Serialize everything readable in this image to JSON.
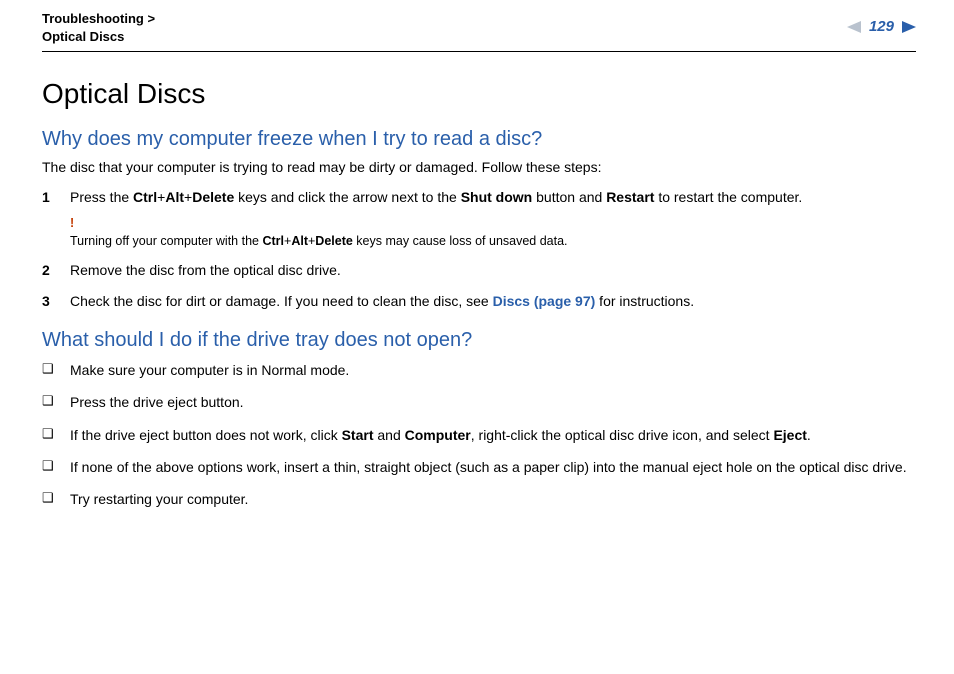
{
  "header": {
    "breadcrumb_section": "Troubleshooting",
    "breadcrumb_sep": " > ",
    "breadcrumb_page": "Optical Discs",
    "page_number": "129"
  },
  "title": "Optical Discs",
  "q1": {
    "heading": "Why does my computer freeze when I try to read a disc?",
    "intro": "The disc that your computer is trying to read may be dirty or damaged. Follow these steps:",
    "step1_a": "Press the ",
    "step1_b": "Ctrl",
    "step1_c": "+",
    "step1_d": "Alt",
    "step1_e": "+",
    "step1_f": "Delete",
    "step1_g": " keys and click the arrow next to the ",
    "step1_h": "Shut down",
    "step1_i": " button and ",
    "step1_j": "Restart",
    "step1_k": " to restart the computer.",
    "warn_bang": "!",
    "warn_a": "Turning off your computer with the ",
    "warn_b": "Ctrl",
    "warn_c": "+",
    "warn_d": "Alt",
    "warn_e": "+",
    "warn_f": "Delete",
    "warn_g": " keys may cause loss of unsaved data.",
    "step2": "Remove the disc from the optical disc drive.",
    "step3_a": "Check the disc for dirt or damage. If you need to clean the disc, see ",
    "step3_b": "Discs (page 97)",
    "step3_c": " for instructions."
  },
  "q2": {
    "heading": "What should I do if the drive tray does not open?",
    "b1": "Make sure your computer is in Normal mode.",
    "b2": "Press the drive eject button.",
    "b3_a": "If the drive eject button does not work, click ",
    "b3_b": "Start",
    "b3_c": " and ",
    "b3_d": "Computer",
    "b3_e": ", right-click the optical disc drive icon, and select ",
    "b3_f": "Eject",
    "b3_g": ".",
    "b4": "If none of the above options work, insert a thin, straight object (such as a paper clip) into the manual eject hole on the optical disc drive.",
    "b5": "Try restarting your computer."
  }
}
